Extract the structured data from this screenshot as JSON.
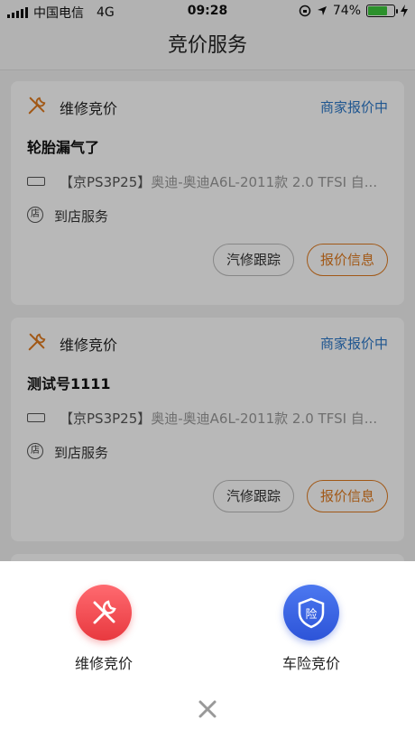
{
  "status_bar": {
    "carrier": "中国电信",
    "network": "4G",
    "time": "09:28",
    "battery": "74%",
    "battery_level": 0.74
  },
  "nav": {
    "title": "竞价服务"
  },
  "cards": [
    {
      "type": "维修竞价",
      "status": "商家报价中",
      "title": "轮胎漏气了",
      "plate": "【京PS3P25】",
      "car": "奥迪-奥迪A6L-2011款 2.0 TFSI 自...",
      "service": "到店服务",
      "service_icon": "店",
      "track_label": "汽修跟踪",
      "quote_label": "报价信息"
    },
    {
      "type": "维修竞价",
      "status": "商家报价中",
      "title": "测试号1111",
      "plate": "【京PS3P25】",
      "car": "奥迪-奥迪A6L-2011款 2.0 TFSI 自...",
      "service": "到店服务",
      "service_icon": "店",
      "track_label": "汽修跟踪",
      "quote_label": "报价信息"
    }
  ],
  "sheet": {
    "repair_label": "维修竞价",
    "insurance_label": "车险竞价",
    "insurance_icon_text": "险"
  },
  "colors": {
    "status_link": "#2c78c8",
    "accent_orange": "#e07b1f",
    "repair_red": "#e8393f",
    "insurance_blue": "#2d54d8"
  }
}
